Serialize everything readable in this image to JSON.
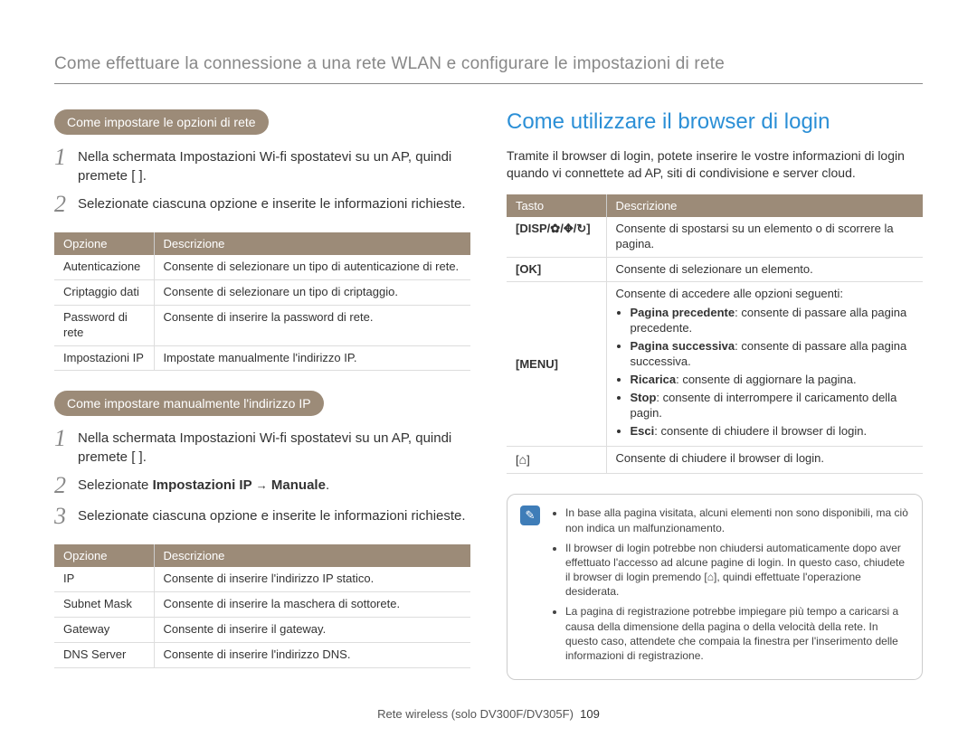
{
  "header": "Come effettuare la connessione a una rete WLAN e configurare le impostazioni di rete",
  "left": {
    "section1": {
      "pill": "Come impostare le opzioni di rete",
      "steps": [
        "Nella schermata Impostazioni Wi-fi spostatevi su un AP, quindi premete [ ].",
        "Selezionate ciascuna opzione e inserite le informazioni richieste."
      ],
      "table": {
        "headers": [
          "Opzione",
          "Descrizione"
        ],
        "rows": [
          [
            "Autenticazione",
            "Consente di selezionare un tipo di autenticazione di rete."
          ],
          [
            "Criptaggio dati",
            "Consente di selezionare un tipo di criptaggio."
          ],
          [
            "Password di rete",
            "Consente di inserire la password di rete."
          ],
          [
            "Impostazioni IP",
            "Impostate manualmente l'indirizzo IP."
          ]
        ]
      }
    },
    "section2": {
      "pill": "Come impostare manualmente l'indirizzo IP",
      "steps": [
        {
          "plain": "Nella schermata Impostazioni Wi-fi spostatevi su un AP, quindi premete [ ]."
        },
        {
          "html": "Selezionate <b>Impostazioni IP</b> → <b>Manuale</b>."
        },
        {
          "plain": "Selezionate ciascuna opzione e inserite le informazioni richieste."
        }
      ],
      "table": {
        "headers": [
          "Opzione",
          "Descrizione"
        ],
        "rows": [
          [
            "IP",
            "Consente di inserire l'indirizzo IP statico."
          ],
          [
            "Subnet Mask",
            "Consente di inserire la maschera di sottorete."
          ],
          [
            "Gateway",
            "Consente di inserire il gateway."
          ],
          [
            "DNS Server",
            "Consente di inserire l'indirizzo DNS."
          ]
        ]
      }
    }
  },
  "right": {
    "title": "Come utilizzare il browser di login",
    "intro": "Tramite il browser di login, potete inserire le vostre informazioni di login quando vi connettete ad AP, siti di condivisione e server cloud.",
    "table": {
      "headers": [
        "Tasto",
        "Descrizione"
      ],
      "rows": [
        {
          "key": "[DISP/♣/♠/⟳]",
          "desc": "Consente di spostarsi su un elemento o di scorrere la pagina."
        },
        {
          "key": "[OK]",
          "desc": "Consente di selezionare un elemento."
        },
        {
          "key": "[MENU]",
          "desc_pre": "Consente di accedere alle opzioni seguenti:",
          "bullets": [
            {
              "b": "Pagina precedente",
              "t": ": consente di passare alla pagina precedente."
            },
            {
              "b": "Pagina successiva",
              "t": ": consente di passare alla pagina successiva."
            },
            {
              "b": "Ricarica",
              "t": ": consente di aggiornare la pagina."
            },
            {
              "b": "Stop",
              "t": ": consente di interrompere il caricamento della pagin."
            },
            {
              "b": "Esci",
              "t": ": consente di chiudere il browser di login."
            }
          ]
        },
        {
          "key": "[⌂]",
          "desc": "Consente di chiudere il browser di login."
        }
      ]
    },
    "notes": [
      "In base alla pagina visitata, alcuni elementi non sono disponibili, ma ciò non indica un malfunzionamento.",
      "Il browser di login potrebbe non chiudersi automaticamente dopo aver effettuato l'accesso ad alcune pagine di login. In questo caso, chiudete il browser di login premendo [⌂], quindi effettuate l'operazione desiderata.",
      "La pagina di registrazione potrebbe impiegare più tempo a caricarsi a causa della dimensione della pagina o della velocità della rete. In questo caso, attendete che compaia la finestra per l'inserimento delle informazioni di registrazione."
    ]
  },
  "footer": {
    "text": "Rete wireless (solo DV300F/DV305F)",
    "page": "109"
  }
}
